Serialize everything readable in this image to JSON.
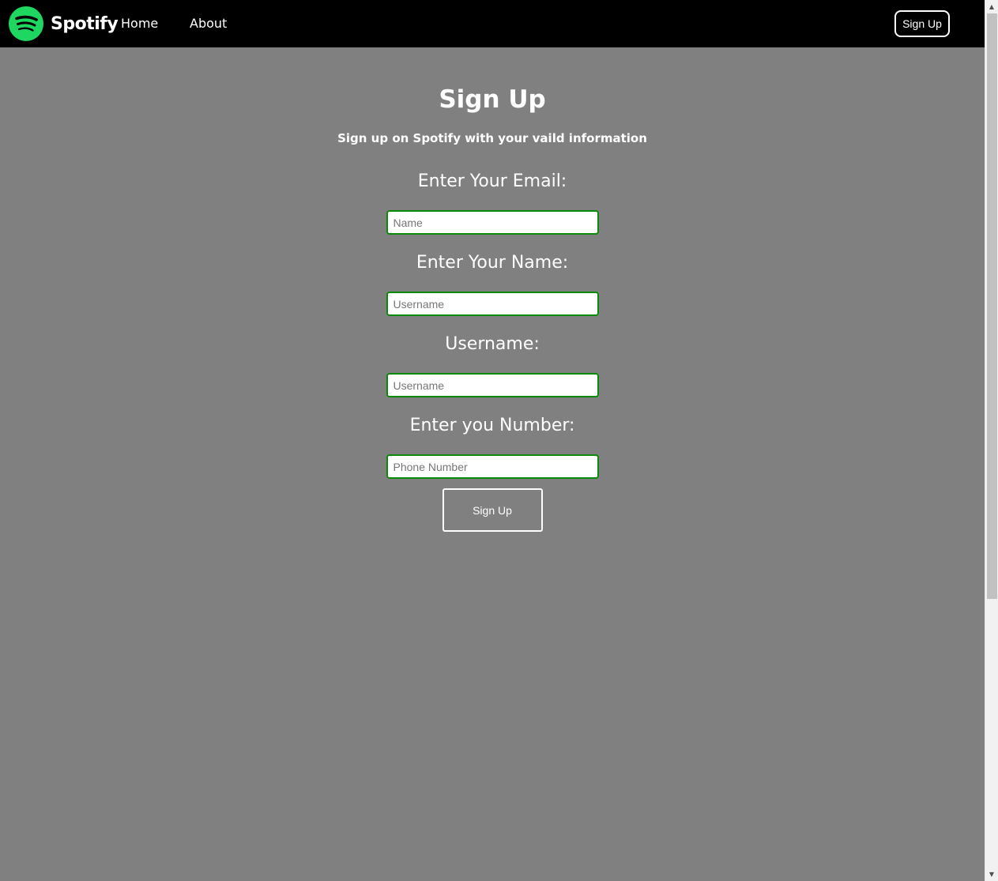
{
  "navbar": {
    "brand": "Spotify",
    "links": [
      {
        "label": "Home"
      },
      {
        "label": "About"
      }
    ],
    "signup_button": "Sign Up",
    "logo_color": "#1ed760"
  },
  "form": {
    "title": "Sign Up",
    "subtitle": "Sign up on Spotify with your vaild information",
    "fields": [
      {
        "label": "Enter Your Email:",
        "placeholder": "Name",
        "value": ""
      },
      {
        "label": "Enter Your Name:",
        "placeholder": "Username",
        "value": ""
      },
      {
        "label": "Username:",
        "placeholder": "Username",
        "value": ""
      },
      {
        "label": "Enter you Number:",
        "placeholder": "Phone Number",
        "value": ""
      }
    ],
    "submit_label": "Sign Up",
    "input_border_color": "#0a8a0a"
  }
}
